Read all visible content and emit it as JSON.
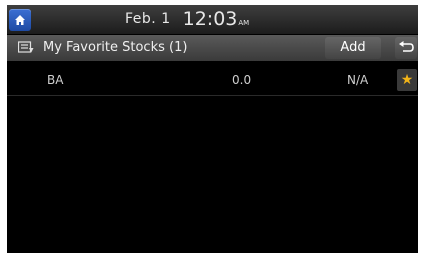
{
  "status": {
    "date": "Feb. 1",
    "time": "12:03",
    "ampm": "AM"
  },
  "header": {
    "title": "My Favorite Stocks (1)",
    "add_label": "Add"
  },
  "stocks": [
    {
      "symbol": "BA",
      "price": "0.0",
      "change": "N/A",
      "favorite": true
    }
  ],
  "colors": {
    "home_button": "#2c5bbf",
    "star": "#f2b418"
  },
  "icons": {
    "home": "home-icon",
    "title": "stock-list-icon",
    "back": "back-arrow-icon",
    "favorite": "star-icon"
  }
}
